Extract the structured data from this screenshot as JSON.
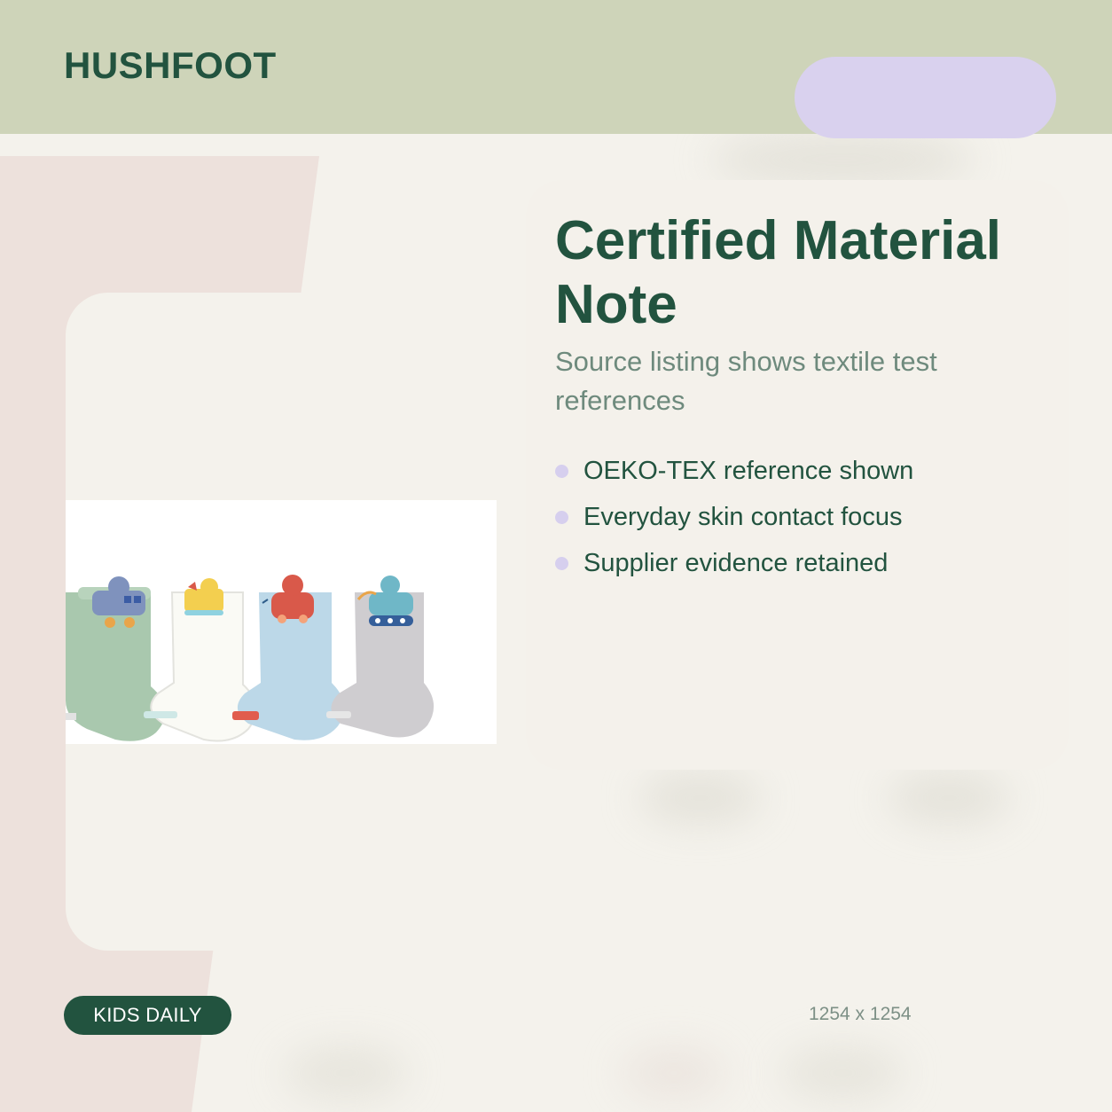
{
  "brand": {
    "name": "HUSHFOOT"
  },
  "hero": {
    "title": "Certified Material Note",
    "subtitle": "Source listing shows textile test references",
    "bullets": [
      {
        "text": "OEKO-TEX reference shown"
      },
      {
        "text": "Everyday skin contact focus"
      },
      {
        "text": "Supplier evidence retained"
      }
    ]
  },
  "product_image": {
    "subject": "four kids socks with vehicle appliques",
    "socks": [
      {
        "color": "#a9c8ae",
        "vehicle": "bus",
        "vehicle_color": "#7f92bd",
        "accent": "#e9a54a"
      },
      {
        "color": "#fafaf5",
        "vehicle": "excavator",
        "vehicle_color": "#f3cf4f",
        "accent": "#8fd2e0"
      },
      {
        "color": "#bcd8e8",
        "vehicle": "car",
        "vehicle_color": "#d9594a",
        "accent": "#e15c4d"
      },
      {
        "color": "#cfcdd0",
        "vehicle": "tank",
        "vehicle_color": "#6fb7c7",
        "accent": "#355f9a"
      }
    ]
  },
  "footer": {
    "tag": "KIDS DAILY",
    "dimensions": "1254 x 1254"
  },
  "colors": {
    "brand_green": "#22533f",
    "header_bg": "#ced4b9",
    "accent_lilac": "#d9d1ee",
    "page_bg": "#f4f2ec",
    "pink_panel": "#ede1dc"
  }
}
